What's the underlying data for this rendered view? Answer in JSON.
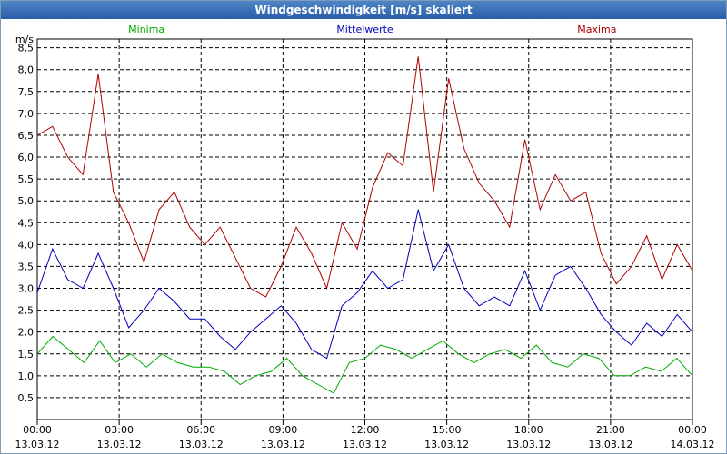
{
  "chart_data": {
    "type": "line",
    "title": "Windgeschwindigkeit [m/s] skaliert",
    "ylabel": "m/s",
    "ylim": [
      0,
      8.7
    ],
    "yticks": [
      "0,5",
      "1,0",
      "1,5",
      "2,0",
      "2,5",
      "3,0",
      "3,5",
      "4,0",
      "4,5",
      "5,0",
      "5,5",
      "6,0",
      "6,5",
      "7,0",
      "7,5",
      "8,0",
      "8,5"
    ],
    "xticks": [
      {
        "time": "00:00",
        "date": "13.03.12"
      },
      {
        "time": "03:00",
        "date": "13.03.12"
      },
      {
        "time": "06:00",
        "date": "13.03.12"
      },
      {
        "time": "09:00",
        "date": "13.03.12"
      },
      {
        "time": "12:00",
        "date": "13.03.12"
      },
      {
        "time": "15:00",
        "date": "13.03.12"
      },
      {
        "time": "18:00",
        "date": "13.03.12"
      },
      {
        "time": "21:00",
        "date": "13.03.12"
      },
      {
        "time": "00:00",
        "date": "14.03.12"
      }
    ],
    "x_hours": [
      0,
      0.5,
      1,
      1.5,
      2,
      2.5,
      3,
      3.5,
      4,
      4.5,
      5,
      5.5,
      6,
      6.5,
      7,
      7.5,
      8,
      8.5,
      9,
      9.5,
      10,
      10.5,
      11,
      11.5,
      12,
      12.5,
      13,
      13.5,
      14,
      14.5,
      15,
      15.5,
      16,
      16.5,
      17,
      17.5,
      18,
      18.5,
      19,
      19.5,
      20,
      20.5,
      21,
      21.5,
      22,
      22.5,
      23,
      23.5,
      24
    ],
    "grid": true,
    "legend": "top",
    "series": [
      {
        "name": "Minima",
        "color": "#00aa00",
        "values": [
          1.5,
          1.9,
          1.6,
          1.3,
          1.8,
          1.3,
          1.5,
          1.2,
          1.5,
          1.3,
          1.2,
          1.2,
          1.1,
          0.8,
          1.0,
          1.1,
          1.4,
          1.0,
          0.8,
          0.6,
          1.3,
          1.4,
          1.7,
          1.6,
          1.4,
          1.6,
          1.8,
          1.5,
          1.3,
          1.5,
          1.6,
          1.4,
          1.7,
          1.3,
          1.2,
          1.5,
          1.4,
          1.0,
          1.0,
          1.2,
          1.1,
          1.4,
          1.0
        ]
      },
      {
        "name": "Mittelwerte",
        "color": "#0000bb",
        "values": [
          2.9,
          3.9,
          3.2,
          3.0,
          3.8,
          3.0,
          2.1,
          2.5,
          3.0,
          2.7,
          2.3,
          2.3,
          1.9,
          1.6,
          2.0,
          2.3,
          2.6,
          2.2,
          1.6,
          1.4,
          2.6,
          2.9,
          3.4,
          3.0,
          3.2,
          4.8,
          3.4,
          4.0,
          3.0,
          2.6,
          2.8,
          2.6,
          3.4,
          2.5,
          3.3,
          3.5,
          3.0,
          2.4,
          2.0,
          1.7,
          2.2,
          1.9,
          2.4,
          2.0
        ]
      },
      {
        "name": "Maxima",
        "color": "#b00000",
        "values": [
          6.5,
          6.7,
          6.0,
          5.6,
          7.9,
          5.2,
          4.5,
          3.6,
          4.8,
          5.2,
          4.4,
          4.0,
          4.4,
          3.7,
          3.0,
          2.8,
          3.5,
          4.4,
          3.8,
          3.0,
          4.5,
          3.9,
          5.3,
          6.1,
          5.8,
          8.3,
          5.2,
          7.8,
          6.2,
          5.4,
          5.0,
          4.4,
          6.4,
          4.8,
          5.6,
          5.0,
          5.2,
          3.8,
          3.1,
          3.5,
          4.2,
          3.2,
          4.0,
          3.4
        ]
      }
    ]
  }
}
